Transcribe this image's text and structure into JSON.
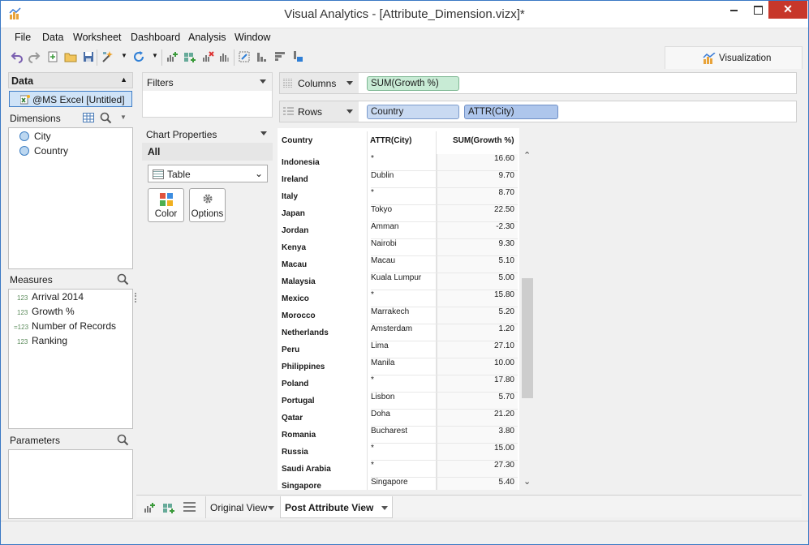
{
  "window": {
    "title": "Visual Analytics - [Attribute_Dimension.vizx]*",
    "close_glyph": "✕"
  },
  "menu": [
    "File",
    "Data",
    "Worksheet",
    "Dashboard",
    "Analysis",
    "Window"
  ],
  "toolbar": {
    "visualization_tab": "Visualization"
  },
  "data_panel": {
    "header": "Data",
    "datasource": "@MS Excel [Untitled]",
    "dimensions_label": "Dimensions",
    "dimensions": [
      "City",
      "Country"
    ],
    "measures_label": "Measures",
    "measures": [
      {
        "label": "Arrival 2014",
        "prefix": "123"
      },
      {
        "label": "Growth %",
        "prefix": "123"
      },
      {
        "label": "Number of Records",
        "prefix": "=123"
      },
      {
        "label": "Ranking",
        "prefix": "123"
      }
    ],
    "parameters_label": "Parameters"
  },
  "filters": {
    "label": "Filters"
  },
  "chart_properties": {
    "label": "Chart Properties",
    "all_label": "All",
    "chart_type": "Table",
    "color_button": "Color",
    "options_button": "Options"
  },
  "shelves": {
    "columns_label": "Columns",
    "columns_pills": [
      "SUM(Growth %)"
    ],
    "rows_label": "Rows",
    "rows_pills": [
      "Country",
      "ATTR(City)"
    ]
  },
  "table": {
    "headers": [
      "Country",
      "ATTR(City)",
      "SUM(Growth %)"
    ],
    "rows": [
      [
        "Indonesia",
        "*",
        "16.60"
      ],
      [
        "Ireland",
        "Dublin",
        "9.70"
      ],
      [
        "Italy",
        "*",
        "8.70"
      ],
      [
        "Japan",
        "Tokyo",
        "22.50"
      ],
      [
        "Jordan",
        "Amman",
        "-2.30"
      ],
      [
        "Kenya",
        "Nairobi",
        "9.30"
      ],
      [
        "Macau",
        "Macau",
        "5.10"
      ],
      [
        "Malaysia",
        "Kuala Lumpur",
        "5.00"
      ],
      [
        "Mexico",
        "*",
        "15.80"
      ],
      [
        "Morocco",
        "Marrakech",
        "5.20"
      ],
      [
        "Netherlands",
        "Amsterdam",
        "1.20"
      ],
      [
        "Peru",
        "Lima",
        "27.10"
      ],
      [
        "Philippines",
        "Manila",
        "10.00"
      ],
      [
        "Poland",
        "*",
        "17.80"
      ],
      [
        "Portugal",
        "Lisbon",
        "5.70"
      ],
      [
        "Qatar",
        "Doha",
        "21.20"
      ],
      [
        "Romania",
        "Bucharest",
        "3.80"
      ],
      [
        "Russia",
        "*",
        "15.00"
      ],
      [
        "Saudi Arabia",
        "*",
        "27.30"
      ],
      [
        "Singapore",
        "Singapore",
        "5.40"
      ]
    ]
  },
  "sheet_tabs": {
    "tabs": [
      "Original View",
      "Post Attribute View"
    ],
    "active": "Post Attribute View"
  }
}
